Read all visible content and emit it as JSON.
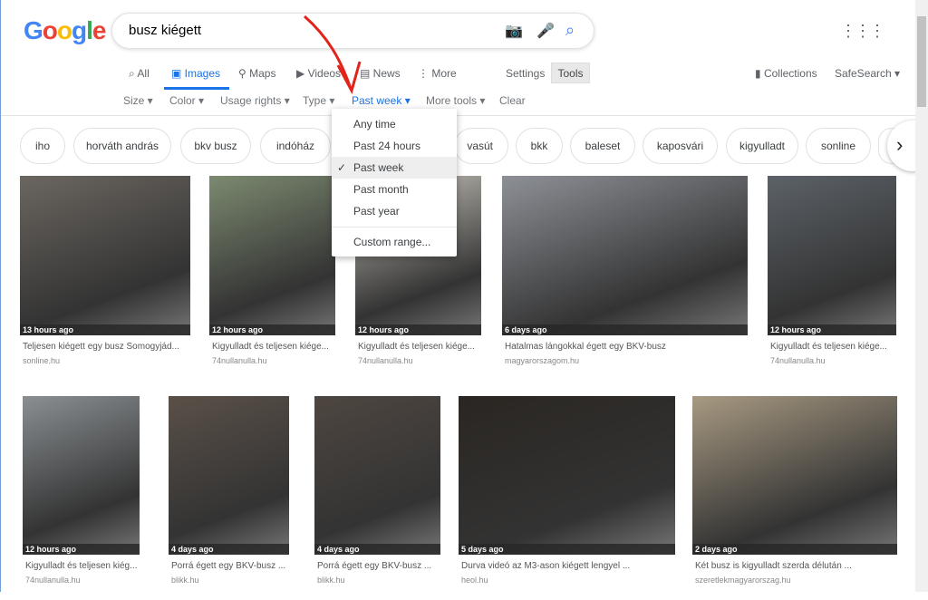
{
  "logo": "Google",
  "search": {
    "query": "busz kiégett"
  },
  "tabs": [
    {
      "label": "All"
    },
    {
      "label": "Images"
    },
    {
      "label": "Maps"
    },
    {
      "label": "Videos"
    },
    {
      "label": "News"
    },
    {
      "label": "More"
    }
  ],
  "settings": "Settings",
  "tools": "Tools",
  "collections": "Collections",
  "safesearch": "SafeSearch ▾",
  "toolbar": [
    {
      "label": "Size ▾"
    },
    {
      "label": "Color ▾"
    },
    {
      "label": "Usage rights ▾"
    },
    {
      "label": "Type ▾"
    },
    {
      "label": "Past week ▾"
    },
    {
      "label": "More tools ▾"
    },
    {
      "label": "Clear"
    }
  ],
  "chips": [
    "iho",
    "horváth andrás",
    "bkv busz",
    "indóház",
    "vasút",
    "bkk",
    "baleset",
    "kaposvári",
    "kigyulladt",
    "sonline"
  ],
  "menu": [
    {
      "label": "Any time"
    },
    {
      "label": "Past 24 hours"
    },
    {
      "label": "Past week",
      "selected": true
    },
    {
      "label": "Past month"
    },
    {
      "label": "Past year"
    },
    {
      "label": "Custom range..."
    }
  ],
  "results": [
    {
      "age": "13 hours ago",
      "title": "Teljesen kiégett egy busz Somogyjád...",
      "source": "sonline.hu"
    },
    {
      "age": "12 hours ago",
      "title": "Kigyulladt és teljesen kiége...",
      "source": "74nullanulla.hu"
    },
    {
      "age": "12 hours ago",
      "title": "Kigyulladt és teljesen kiége...",
      "source": "74nullanulla.hu"
    },
    {
      "age": "6 days ago",
      "title": "Hatalmas lángokkal égett egy BKV-busz",
      "source": "magyarorszagom.hu"
    },
    {
      "age": "12 hours ago",
      "title": "Kigyulladt és teljesen kiége...",
      "source": "74nullanulla.hu"
    },
    {
      "age": "12 hours ago",
      "title": "Kigyulladt és teljesen kiég...",
      "source": "74nullanulla.hu"
    },
    {
      "age": "4 days ago",
      "title": "Porrá égett egy BKV-busz ...",
      "source": "blikk.hu"
    },
    {
      "age": "4 days ago",
      "title": "Porrá égett egy BKV-busz ...",
      "source": "blikk.hu"
    },
    {
      "age": "5 days ago",
      "title": "Durva videó az M3-ason kiégett lengyel ...",
      "source": "heol.hu"
    },
    {
      "age": "2 days ago",
      "title": "Két busz is kigyulladt szerda délután ...",
      "source": "szeretlekmagyarorszag.hu"
    }
  ]
}
